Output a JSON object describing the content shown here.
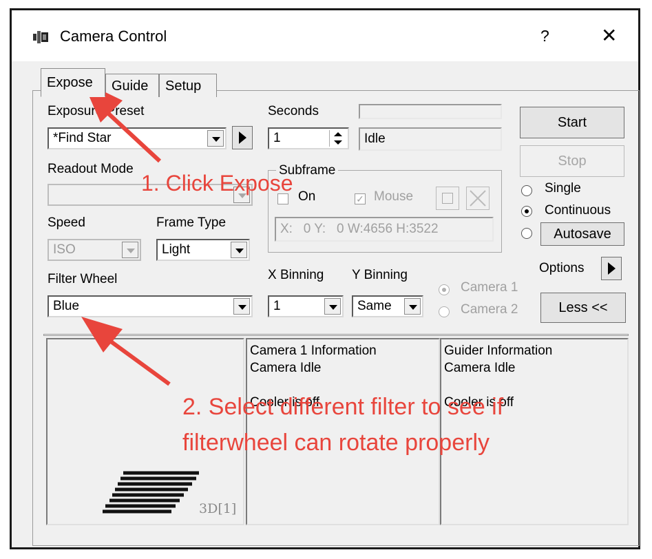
{
  "window": {
    "title": "Camera Control",
    "help_label": "?",
    "close_label": "✕"
  },
  "tabs": [
    {
      "label": "Expose",
      "active": true
    },
    {
      "label": "Guide",
      "active": false
    },
    {
      "label": "Setup",
      "active": false
    }
  ],
  "exposure_preset": {
    "label": "Exposure Preset",
    "value": "*Find Star"
  },
  "seconds": {
    "label": "Seconds",
    "value": "1"
  },
  "status": {
    "value": "Idle"
  },
  "readout_mode": {
    "label": "Readout Mode",
    "value": ""
  },
  "subframe": {
    "label": "Subframe",
    "on_label": "On",
    "on_checked": false,
    "mouse_label": "Mouse",
    "mouse_checked": true,
    "coords": "X:   0 Y:   0 W:4656 H:3522"
  },
  "speed": {
    "label": "Speed",
    "value": "ISO"
  },
  "frame_type": {
    "label": "Frame Type",
    "value": "Light"
  },
  "filter_wheel": {
    "label": "Filter Wheel",
    "value": "Blue"
  },
  "x_binning": {
    "label": "X Binning",
    "value": "1"
  },
  "y_binning": {
    "label": "Y Binning",
    "value": "Same"
  },
  "camera_select": {
    "camera1": "Camera 1",
    "camera2": "Camera 2",
    "selected": "Camera 1"
  },
  "buttons": {
    "start": "Start",
    "stop": "Stop",
    "autosave": "Autosave",
    "options": "Options",
    "less": "Less <<"
  },
  "mode": {
    "single": "Single",
    "continuous": "Continuous",
    "selected": "Continuous"
  },
  "preview": {
    "label": "3D[1]"
  },
  "camera1_info": {
    "line1": "Camera 1 Information",
    "line2": "Camera Idle",
    "line3": "Cooler is off"
  },
  "guider_info": {
    "line1": "Guider Information",
    "line2": "Camera Idle",
    "line3": "Cooler is off"
  },
  "annotations": {
    "step1": "1. Click Expose",
    "step2_line1": "2. Select different filter to see if",
    "step2_line2": "filterwheel can rotate properly",
    "color": "#e8453c"
  }
}
